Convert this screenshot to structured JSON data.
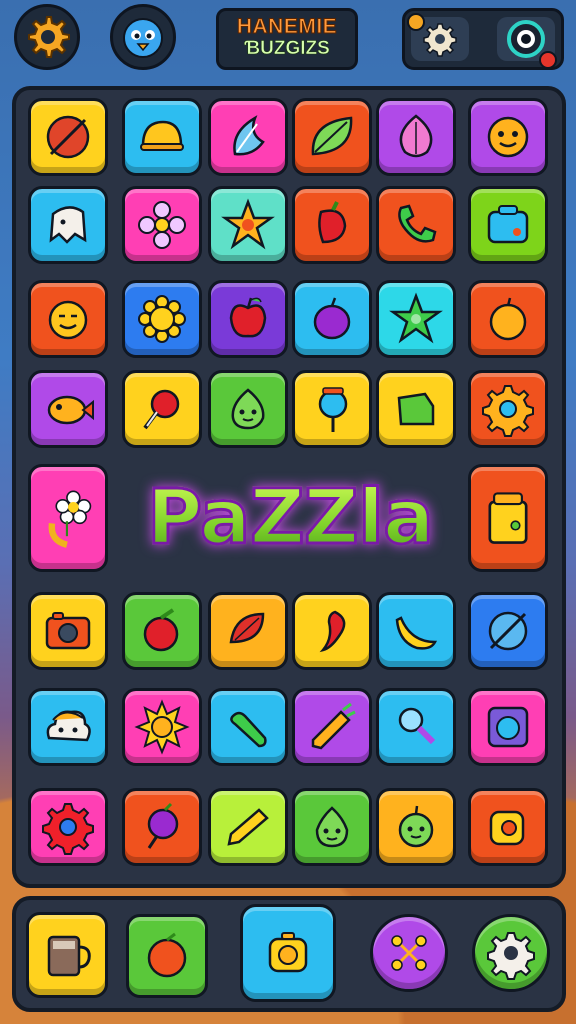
{
  "header": {
    "title_line1": "HANEMIE",
    "title_line2": "ƁUZGIZS",
    "settings_icon": "gear-icon",
    "avatar_icon": "bird-icon",
    "options_icon": "gear-icon",
    "record_icon": "camera-lens-icon",
    "accent": "#ff9a3c"
  },
  "board": {
    "banner_text": "PaZZla",
    "rows": [
      [
        "ball",
        "helmet",
        "feather",
        "leaf",
        "onion",
        "smiley-face"
      ],
      [
        "ghost",
        "flower",
        "star-flower",
        "pepper",
        "phone",
        "box"
      ],
      [
        "smiley-face",
        "sun",
        "apple",
        "plum",
        "star",
        "orange"
      ],
      [
        "fish",
        "pin",
        "blob-face",
        "lollipop",
        "block",
        "gear"
      ],
      [
        "flower-banana",
        "banner",
        "banner",
        "banner",
        "banner",
        "jar"
      ],
      [
        "camera",
        "tomato",
        "seed",
        "chili",
        "banana",
        "planet"
      ],
      [
        "cloud-face",
        "sun",
        "cucumber",
        "carrot",
        "magnifier",
        "washer"
      ],
      [
        "flower",
        "beet",
        "pencil",
        "pear-face",
        "apple-face",
        "cup"
      ]
    ]
  },
  "dock": {
    "items": [
      "mug-icon",
      "orange-icon",
      "camera-icon",
      "link-icon",
      "gear-icon"
    ]
  }
}
